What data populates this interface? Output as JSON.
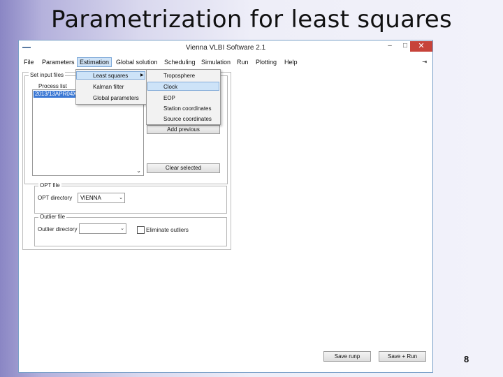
{
  "slide": {
    "title": "Parametrization for least squares",
    "page_number": "8"
  },
  "window": {
    "title": "Vienna VLBI Software 2.1",
    "app_icon": "vievs-app-icon",
    "min_label": "–",
    "max_label": "□",
    "close_label": "✕"
  },
  "menubar": {
    "items": [
      "File",
      "Parameters",
      "Estimation",
      "Global solution",
      "Scheduling",
      "Simulation",
      "Run",
      "Plotting",
      "Help"
    ],
    "pin": "⇥"
  },
  "estimation_menu": {
    "items": [
      "Least squares",
      "Kalman filter",
      "Global parameters"
    ],
    "arrow": "▶"
  },
  "least_squares_submenu": {
    "items": [
      "Troposphere",
      "Clock",
      "EOP",
      "Station coordinates",
      "Source coordinates"
    ],
    "highlighted": "Clock"
  },
  "panel": {
    "set_input_label": "Set input files",
    "process_list_label": "Process list",
    "selected_item": "2013/13APR04XA_N004",
    "add_previous_label": "Add previous",
    "clear_selected_label": "Clear selected",
    "scroll_down": "⌄",
    "opt_file_label": "OPT file",
    "opt_directory_label": "OPT directory",
    "opt_directory_value": "VIENNA",
    "outlier_file_label": "Outlier file",
    "outlier_directory_label": "Outlier directory",
    "outlier_directory_value": "",
    "eliminate_outliers_label": "Eliminate outliers",
    "eliminate_outliers_checked": false,
    "combo_arrow": "⌄"
  },
  "footer": {
    "save_runp_label": "Save runp",
    "save_run_label": "Save + Run"
  }
}
